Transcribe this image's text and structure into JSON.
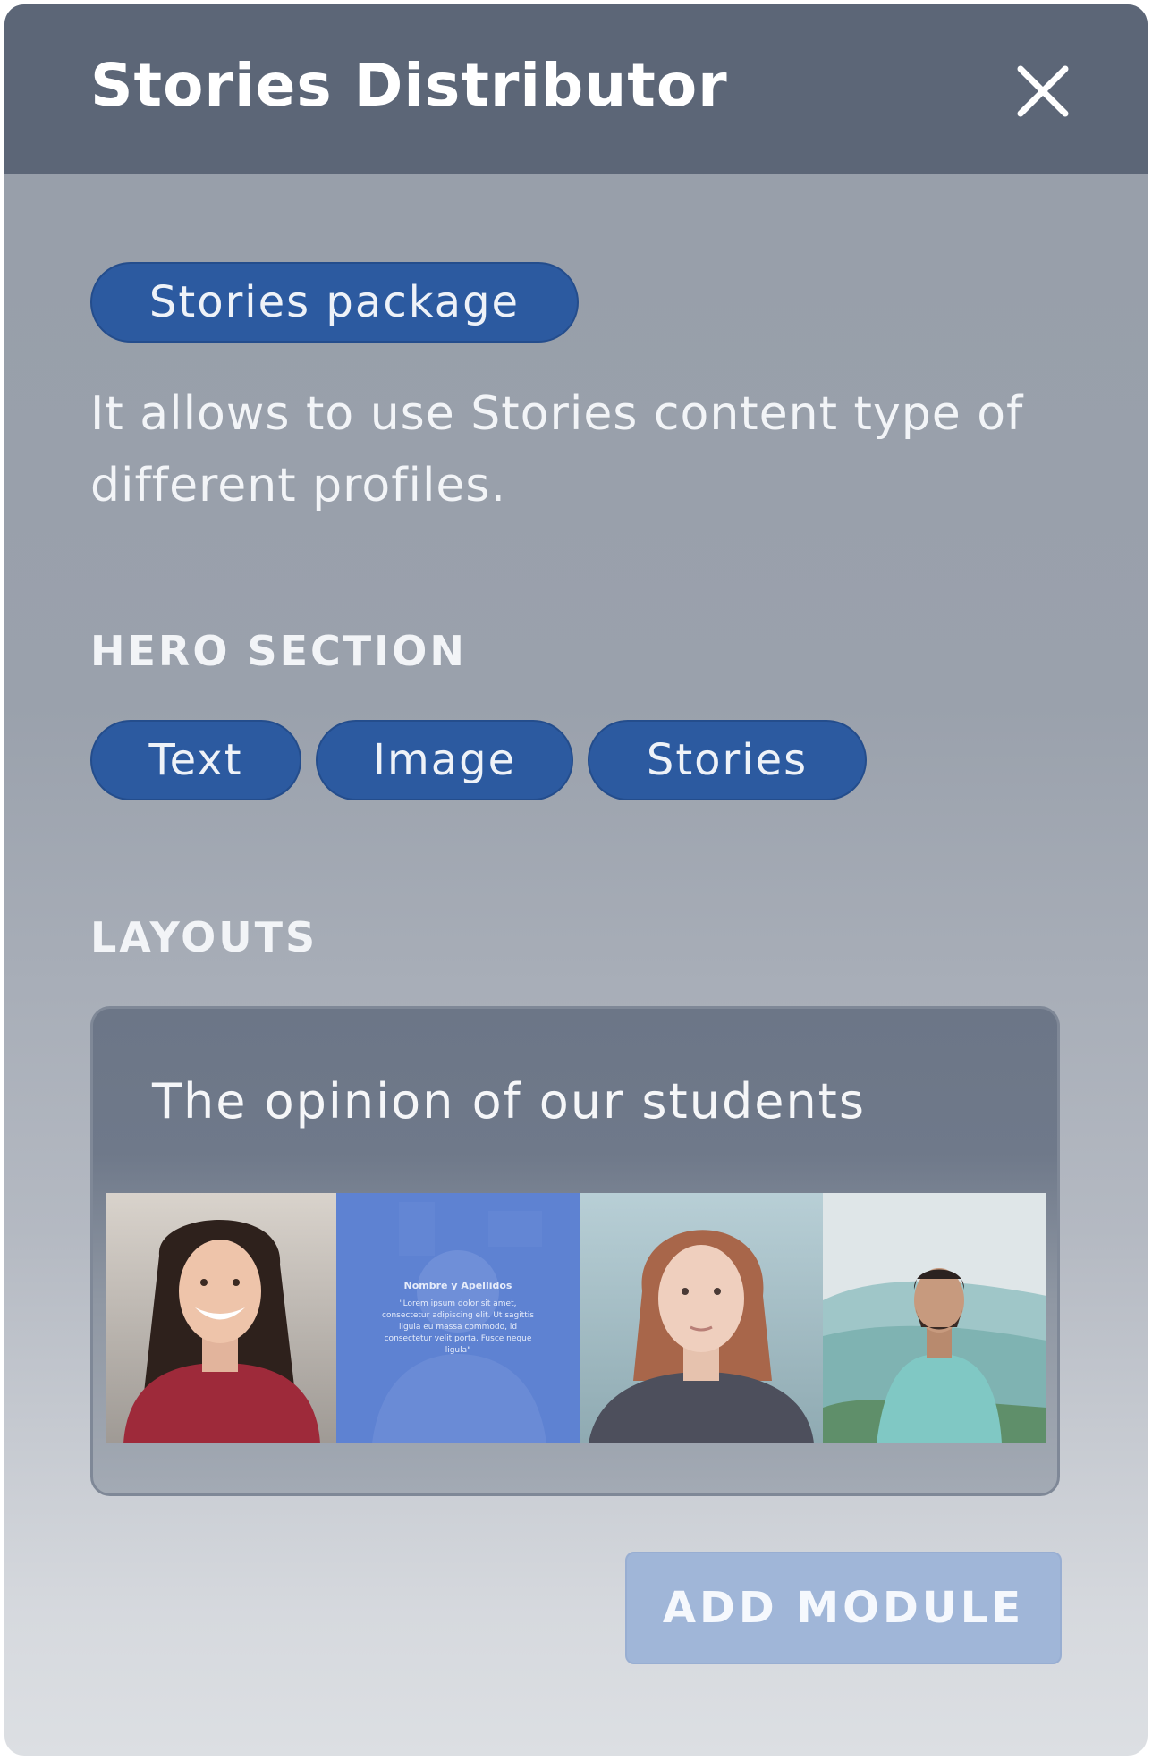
{
  "dialog": {
    "title": "Stories Distributor",
    "close_icon": "close-icon"
  },
  "package": {
    "badge_label": "Stories package",
    "description": "It allows to use Stories content type of different profiles."
  },
  "hero_section": {
    "label": "HERO SECTION",
    "options": [
      {
        "label": "Text"
      },
      {
        "label": "Image"
      },
      {
        "label": "Stories"
      }
    ]
  },
  "layouts": {
    "label": "LAYOUTS",
    "card": {
      "title": "The opinion of our students",
      "quote_card": {
        "name": "Nombre y Apellidos",
        "text": "\"Lorem ipsum dolor sit amet, consectetur adipiscing elit. Ut sagittis ligula eu massa commodo, id consectetur velit porta. Fusce neque ligula\""
      }
    }
  },
  "actions": {
    "add_module_label": "ADD MODULE"
  },
  "colors": {
    "header_bg": "#5c6677",
    "pill_bg": "#2c5aa0",
    "button_bg": "#a0b6d8"
  }
}
